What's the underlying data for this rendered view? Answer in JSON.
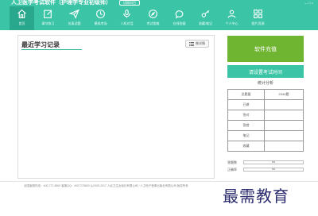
{
  "header": {
    "title": "人卫医学考试软件（护理学专业初级师）",
    "version_label": "切换科目",
    "window_controls": "— □ ×"
  },
  "nav": [
    {
      "label": "首页",
      "icon": "home-icon"
    },
    {
      "label": "章节练习",
      "icon": "edit-icon"
    },
    {
      "label": "仿真试题",
      "icon": "paper-plane-icon"
    },
    {
      "label": "模拟考场",
      "icon": "clock-icon"
    },
    {
      "label": "人机对话",
      "icon": "microphone-icon"
    },
    {
      "label": "考试指南",
      "icon": "compass-icon"
    },
    {
      "label": "在线答疑",
      "icon": "chat-bubble-icon"
    },
    {
      "label": "收藏/笔记",
      "icon": "key-icon"
    },
    {
      "label": "个人中心",
      "icon": "user-icon"
    },
    {
      "label": "图片资源",
      "icon": "grid-icon"
    }
  ],
  "main": {
    "section_title": "最近学习记录",
    "detail_button": "做详情",
    "detail_icon": "list-icon"
  },
  "sidebar": {
    "charge_button": "软件充值",
    "exam_button": "请设置考试时间",
    "stats_title": "统计分析",
    "stats_rows": [
      {
        "label": "总题量",
        "value": "2340题"
      },
      {
        "label": "已做",
        "value": ""
      },
      {
        "label": "答对",
        "value": ""
      },
      {
        "label": "答错",
        "value": ""
      },
      {
        "label": "笔记",
        "value": ""
      },
      {
        "label": "收藏",
        "value": ""
      }
    ],
    "progress": [
      {
        "label": "答题数",
        "text": "0%",
        "fraction": 0
      },
      {
        "label": "正确率",
        "text": "0%",
        "fraction": 0
      }
    ]
  },
  "footer": {
    "text": "全国客服热线：400-727-8800  客服QQ：4007278800  从2005-2017 人民卫生出版社有限公司 / 人卫电子音像出版社有限公司 版权所有"
  },
  "watermark": "最需教育",
  "colors": {
    "header": "#3cc4a6",
    "nav_active": "#2aa88d",
    "charge": "#70b532",
    "exam": "#3cc4a6"
  }
}
